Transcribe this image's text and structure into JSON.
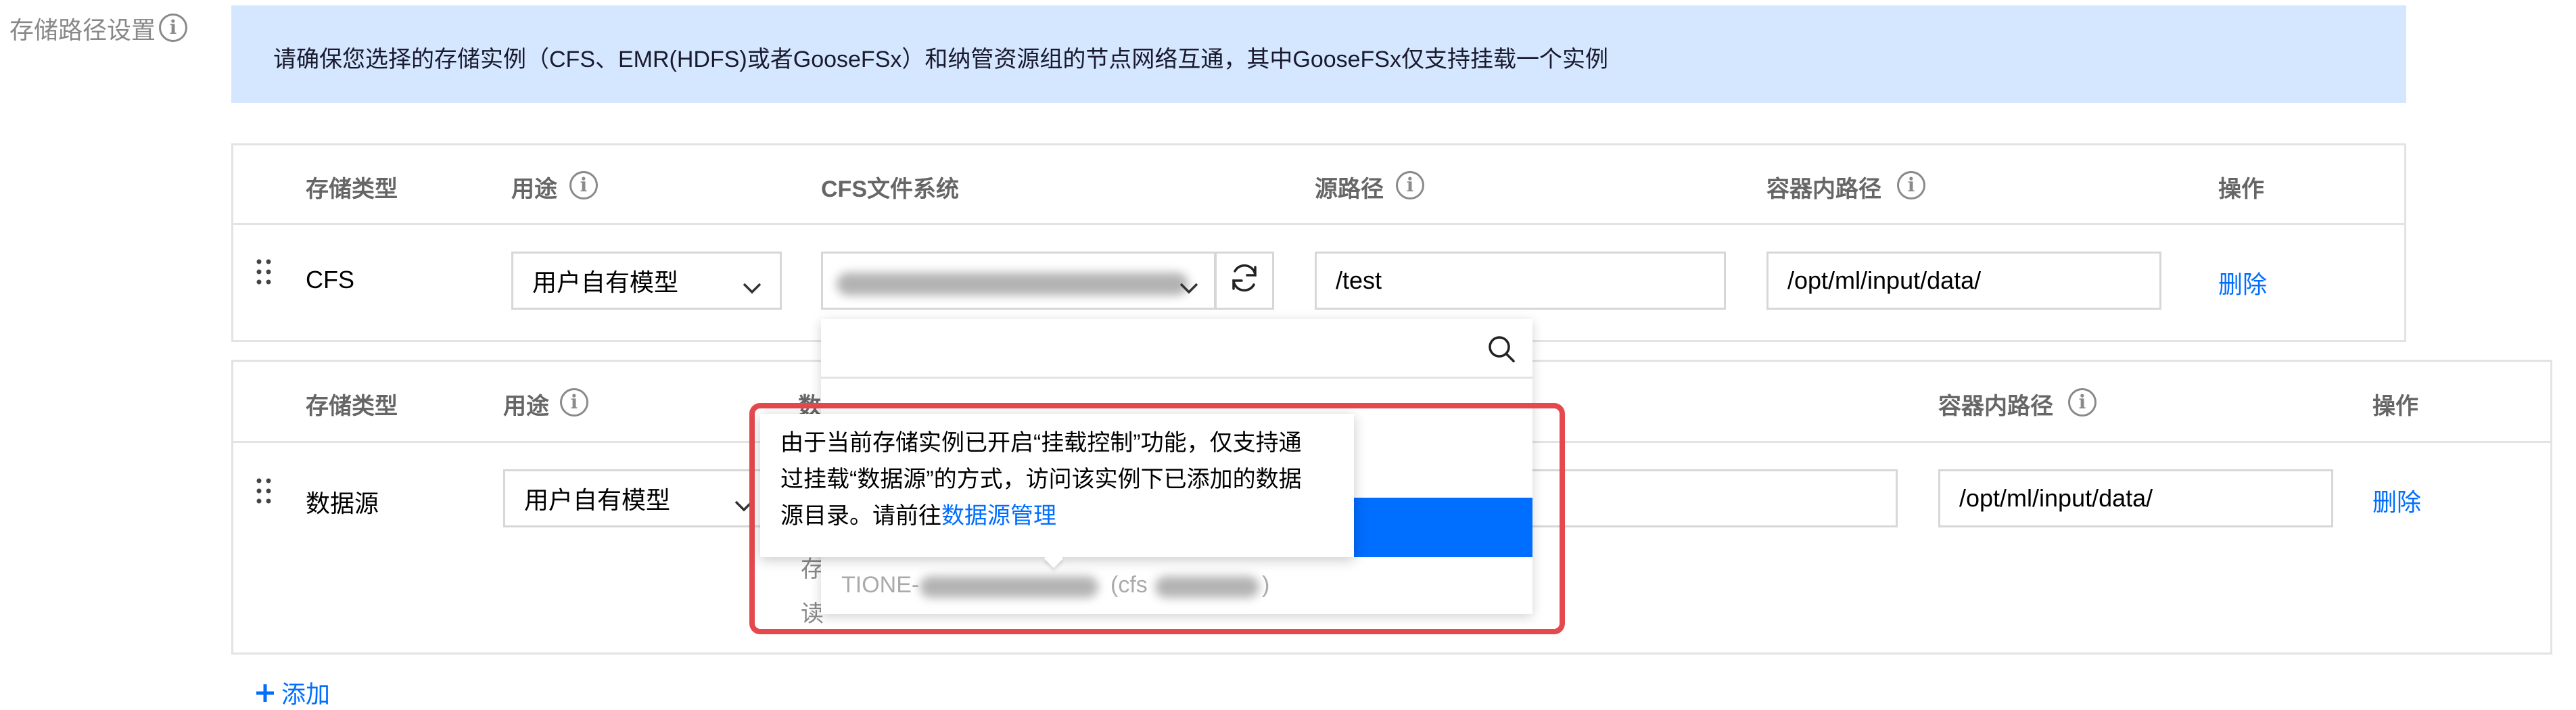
{
  "section_label": "存储路径设置",
  "notice": "请确保您选择的存储实例（CFS、EMR(HDFS)或者GooseFSx）和纳管资源组的节点网络互通，其中GooseFSx仅支持挂载一个实例",
  "table1": {
    "headers": {
      "type": "存储类型",
      "usage": "用途",
      "fs": "CFS文件系统",
      "source": "源路径",
      "container": "容器内路径",
      "ops": "操作"
    },
    "row": {
      "type": "CFS",
      "usage": "用户自有模型",
      "source": "/test",
      "container": "/opt/ml/input/data/",
      "delete": "删除"
    }
  },
  "table2": {
    "headers": {
      "type": "存储类型",
      "usage": "用途",
      "fs_partial": "数",
      "container": "容器内路径",
      "ops": "操作"
    },
    "row": {
      "type": "数据源",
      "usage": "用户自有模型",
      "container": "/opt/ml/input/data/",
      "delete": "删除",
      "sub1": "存",
      "sub2": "读"
    }
  },
  "dropdown": {
    "option_prefix": "TIONE-",
    "option_middle": "(cfs",
    "option_suffix": ")"
  },
  "tooltip": {
    "line1": "由于当前存储实例已开启“挂载控制”功能，仅支持通",
    "line2": "过挂载“数据源”的方式，访问该实例下已添加的数据",
    "line3_prefix": "源目录。请前往",
    "line3_link": "数据源管理"
  },
  "add_label": "添加",
  "colors": {
    "accent": "#006eff",
    "notice_bg": "#d5e6ff",
    "highlight_border": "#e5484d"
  }
}
